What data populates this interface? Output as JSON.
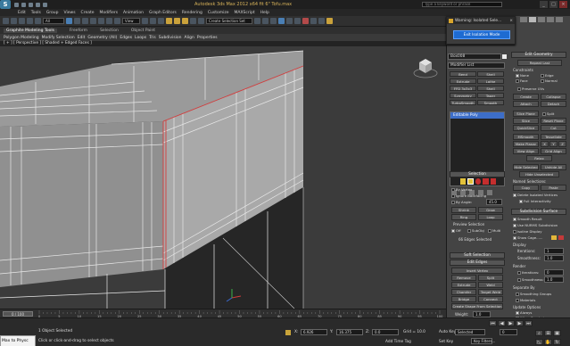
{
  "app": {
    "title": "Autodesk 3ds Max 2012 x64     fit 6\" Tofu.max",
    "search_placeholder": "Type a keyword or phrase",
    "min": "_",
    "max": "□",
    "close": "×"
  },
  "menu": [
    "Edit",
    "Tools",
    "Group",
    "Views",
    "Create",
    "Modifiers",
    "Animation",
    "Graph Editors",
    "Rendering",
    "Customize",
    "MAXScript",
    "Help"
  ],
  "toolbar": {
    "filter": "All",
    "view": "View",
    "named_sel": "Create Selection Set"
  },
  "ribbon": {
    "tabs": [
      "Graphite Modeling Tools",
      "Freeform",
      "Selection",
      "Object Paint"
    ],
    "sub": [
      "Polygon Modeling",
      "Modify Selection",
      "Edit",
      "Geometry (All)",
      "Edges",
      "Loops",
      "Tris",
      "Subdivision",
      "Align",
      "Properties"
    ]
  },
  "viewport": {
    "label": "[ + ] [ Perspective ] [ Shaded + Edged Faces ]"
  },
  "isolate_dialog": {
    "title": "Warning: Isolated Sele...",
    "close": "×",
    "button": "Exit Isolation Mode"
  },
  "modify": {
    "object_name": "Box008",
    "modifier_list": "Modifier List",
    "buttons": [
      "Bend",
      "Shell",
      "Extrude",
      "Lathe",
      "FFD 3x3x3",
      "Shell",
      "Symmetry",
      "Taper",
      "TurboSmooth",
      "Smooth"
    ],
    "stack_item": "Editable Poly"
  },
  "selection": {
    "header": "Selection",
    "by_vertex": "By Vertex",
    "ignore_backfacing": "Ignore Backfacing",
    "by_angle": "By Angle:",
    "angle_value": "45.0",
    "shrink": "Shrink",
    "grow": "Grow",
    "ring": "Ring",
    "loop": "Loop",
    "preview": "Preview Selection",
    "off": "Off",
    "subobj": "SubObj",
    "multi": "Multi",
    "status": "66 Edges Selected"
  },
  "soft_selection": {
    "header": "Soft Selection"
  },
  "edit_edges": {
    "header": "Edit Edges",
    "insert_vertex": "Insert Vertex",
    "remove": "Remove",
    "split": "Split",
    "extrude": "Extrude",
    "weld": "Weld",
    "chamfer": "Chamfer",
    "target_weld": "Target Weld",
    "bridge": "Bridge",
    "connect": "Connect",
    "create_shape": "Create Shape From Selection",
    "weight_label": "Weight:",
    "weight": "1.0",
    "crease_label": "Crease:",
    "crease": "0.0"
  },
  "edit_geometry": {
    "header": "Edit Geometry",
    "repeat_last": "Repeat Last",
    "constraints": "Constraints",
    "none": "None",
    "edge": "Edge",
    "face": "Face",
    "normal": "Normal",
    "preserve_uvs": "Preserve UVs",
    "create": "Create",
    "collapse": "Collapse",
    "attach": "Attach",
    "detach": "Detach",
    "slice_plane": "Slice Plane",
    "split": "Split",
    "slice": "Slice",
    "reset_plane": "Reset Plane",
    "quickslice": "QuickSlice",
    "cut": "Cut",
    "msmooth": "MSmooth",
    "tessellate": "Tessellate",
    "make_planar": "Make Planar",
    "x": "X",
    "y": "Y",
    "z": "Z",
    "view_align": "View Align",
    "grid_align": "Grid Align",
    "relax": "Relax",
    "hide_selected": "Hide Selected",
    "unhide_all": "Unhide All",
    "hide_unselected": "Hide Unselected",
    "named_selections": "Named Selections:",
    "copy": "Copy",
    "paste": "Paste",
    "delete_isolated": "Delete Isolated Vertices",
    "full_interactivity": "Full Interactivity"
  },
  "subdivision": {
    "header": "Subdivision Surface",
    "smooth_result": "Smooth Result",
    "use_nurms": "Use NURMS Subdivision",
    "isoline": "Isoline Display",
    "show_cage": "Show Cage......",
    "display": "Display",
    "iterations_label": "Iterations:",
    "iterations": "1",
    "smoothness_label": "Smoothness:",
    "smoothness": "1.0",
    "render": "Render",
    "r_iterations": "0",
    "r_smoothness": "1.0",
    "separate_by": "Separate By",
    "smoothing_groups": "Smoothing Groups",
    "materials": "Materials",
    "update_options": "Update Options",
    "always": "Always",
    "when_rendering": "When Rendering",
    "manually": "Manually"
  },
  "timeline": {
    "frame": "0 / 100",
    "ticks": [
      "0",
      "5",
      "10",
      "15",
      "20",
      "25",
      "30",
      "35",
      "40",
      "45",
      "50",
      "55",
      "60",
      "65",
      "70",
      "75",
      "80",
      "85",
      "90",
      "95",
      "100"
    ]
  },
  "status": {
    "maxscript": "Max to Physc",
    "objects": "1 Object Selected",
    "prompt": "Click or click-and-drag to select objects",
    "x_label": "X:",
    "x": "6.926",
    "y_label": "Y:",
    "y": "16.375",
    "z_label": "Z:",
    "z": "0.0",
    "grid": "Grid = 10.0",
    "add_time_tag": "Add Time Tag",
    "auto_key": "Auto Key",
    "selected": "Selected",
    "set_key": "Set Key",
    "key_filters": "Key Filters...",
    "frame_field": "0"
  }
}
